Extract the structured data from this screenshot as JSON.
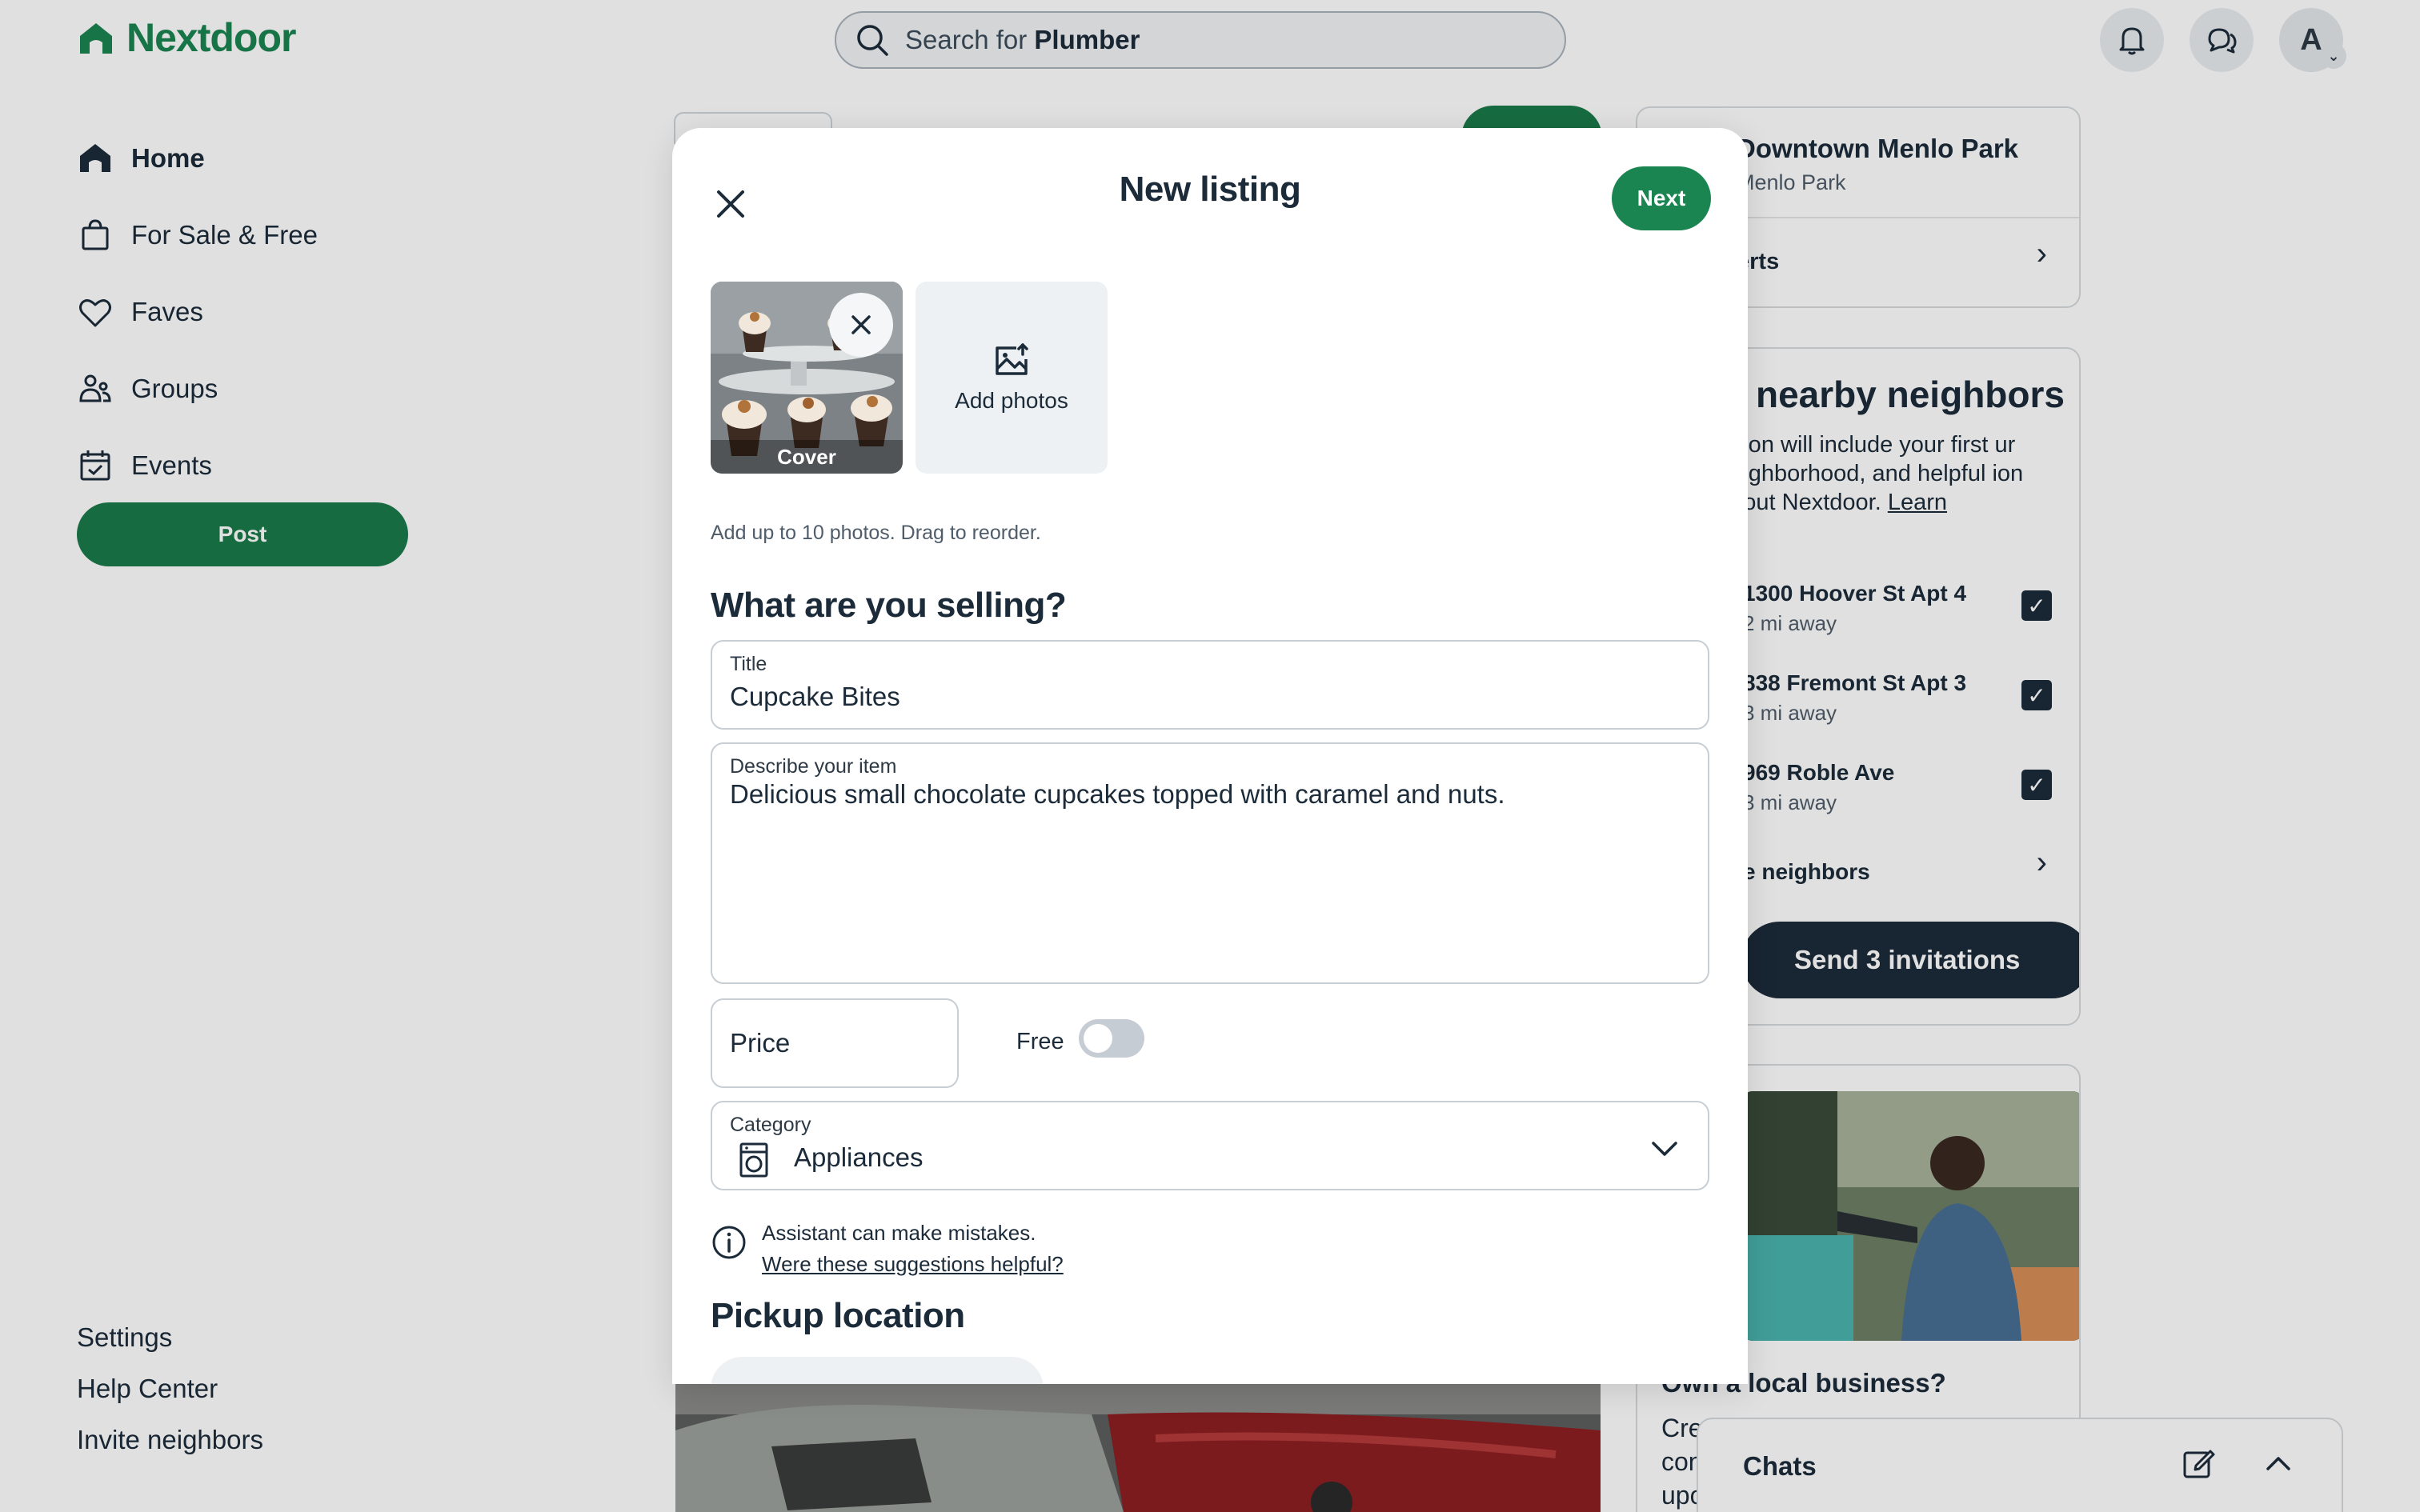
{
  "header": {
    "logo_text": "Nextdoor",
    "search_prefix": "Search for",
    "search_term": "Plumber",
    "avatar_initial": "A"
  },
  "nav": {
    "items": [
      {
        "label": "Home",
        "icon": "home-icon"
      },
      {
        "label": "For Sale & Free",
        "icon": "shopping-bag-icon"
      },
      {
        "label": "Faves",
        "icon": "heart-icon"
      },
      {
        "label": "Groups",
        "icon": "groups-icon"
      },
      {
        "label": "Events",
        "icon": "calendar-icon"
      }
    ],
    "post_label": "Post"
  },
  "footer_links": [
    "Settings",
    "Help Center",
    "Invite neighbors"
  ],
  "right_rail": {
    "neighborhood": {
      "title": "Downtown Menlo Park",
      "subtitle": "Menlo Park",
      "row": "erts"
    },
    "invite": {
      "title": "nearby neighbors",
      "desc_pre": "tation will include your first ur neighborhood, and helpful ion about Nextdoor.",
      "desc_link": "Learn",
      "addresses": [
        {
          "line1": "1300 Hoover St Apt 4",
          "line2": "2 mi away"
        },
        {
          "line1": "838 Fremont St Apt 3",
          "line2": "3 mi away"
        },
        {
          "line1": "969 Roble Ave",
          "line2": "3 mi away"
        }
      ],
      "more": "e neighbors",
      "button": "Send 3 invitations"
    },
    "business": {
      "title": "Own a local business?",
      "text": "Cre con upo"
    }
  },
  "chats": {
    "label": "Chats"
  },
  "modal": {
    "title": "New listing",
    "next_label": "Next",
    "cover_label": "Cover",
    "add_photos_label": "Add photos",
    "photo_hint": "Add up to 10 photos. Drag to reorder.",
    "selling_heading": "What are you selling?",
    "title_field": {
      "label": "Title",
      "value": "Cupcake Bites"
    },
    "desc_field": {
      "label": "Describe your item",
      "value": "Delicious small chocolate cupcakes topped with caramel and nuts."
    },
    "price_placeholder": "Price",
    "free_label": "Free",
    "free_enabled": false,
    "category": {
      "label": "Category",
      "value": "Appliances"
    },
    "assistant_note": "Assistant can make mistakes.",
    "assistant_link": "Were these suggestions helpful?",
    "pickup_heading": "Pickup location"
  },
  "colors": {
    "brand_green": "#1b8551",
    "dark_button": "#1c2b39",
    "toggle_off": "#c6ccd3"
  }
}
